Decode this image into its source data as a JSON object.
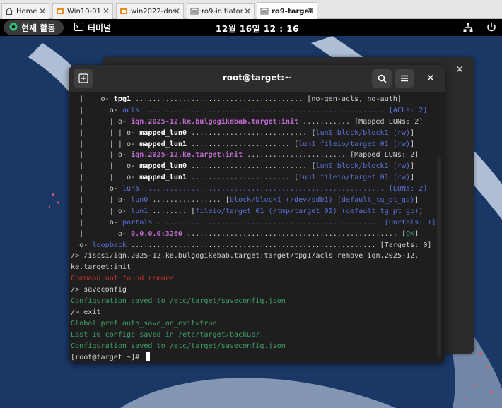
{
  "vm_tabs": [
    {
      "label": "Home",
      "icon": "home-icon",
      "active": false
    },
    {
      "label": "Win10-01",
      "icon": "vm-icon",
      "active": false
    },
    {
      "label": "win2022-dns",
      "icon": "vm-icon",
      "active": false
    },
    {
      "label": "ro9-initiator",
      "icon": "vm-icon",
      "active": false
    },
    {
      "label": "ro9-target",
      "icon": "vm-icon",
      "active": true
    }
  ],
  "topbar": {
    "activities": "현재 활동",
    "app_name": "터미널",
    "clock": "12월 16일  12 : 16"
  },
  "terminal": {
    "title": "root@target:~",
    "lines": [
      [
        {
          "t": "  |    o- "
        },
        {
          "t": "tpg1",
          "c": "c-b"
        },
        {
          "t": " ....................................... [no-gen-acls, no-auth]"
        }
      ],
      [
        {
          "t": "  |      o- "
        },
        {
          "t": "acls",
          "c": "c-blue"
        },
        {
          "t": " ........................................................ [ACLs: 2]",
          "c": "c-blue"
        }
      ],
      [
        {
          "t": "  |      | o- "
        },
        {
          "t": "iqn.2025-12.ke.bulgogikebab.target:init",
          "c": "c-mag"
        },
        {
          "t": " ........... [Mapped LUNs: 2]"
        }
      ],
      [
        {
          "t": "  |      | | o- "
        },
        {
          "t": "mapped_lun0",
          "c": "c-b"
        },
        {
          "t": " ........................... ["
        },
        {
          "t": "lun0 block/block1 (rw)",
          "c": "c-blue"
        },
        {
          "t": "]"
        }
      ],
      [
        {
          "t": "  |      | | o- "
        },
        {
          "t": "mapped_lun1",
          "c": "c-b"
        },
        {
          "t": " ....................... ["
        },
        {
          "t": "lun1 fileio/target_01 (rw)",
          "c": "c-blue"
        },
        {
          "t": "]"
        }
      ],
      [
        {
          "t": "  |      | o- "
        },
        {
          "t": "iqn.2025-12.ke.target:init",
          "c": "c-mag"
        },
        {
          "t": " ....................... [Mapped LUNs: 2]"
        }
      ],
      [
        {
          "t": "  |      |   o- "
        },
        {
          "t": "mapped_lun0",
          "c": "c-b"
        },
        {
          "t": " ........................... ["
        },
        {
          "t": "lun0 block/block1 (rw)",
          "c": "c-blue"
        },
        {
          "t": "]"
        }
      ],
      [
        {
          "t": "  |      |   o- "
        },
        {
          "t": "mapped_lun1",
          "c": "c-b"
        },
        {
          "t": " ....................... ["
        },
        {
          "t": "lun1 fileio/target_01 (rw)",
          "c": "c-blue"
        },
        {
          "t": "]"
        }
      ],
      [
        {
          "t": "  |      o- "
        },
        {
          "t": "luns",
          "c": "c-blue"
        },
        {
          "t": " ........................................................ [LUNs: 2]",
          "c": "c-blue"
        }
      ],
      [
        {
          "t": "  |      | o- "
        },
        {
          "t": "lun0",
          "c": "c-blue"
        },
        {
          "t": " ................ ["
        },
        {
          "t": "block/block1 (/dev/sdb1) (default_tg_pt_gp)",
          "c": "c-blue"
        },
        {
          "t": "]"
        }
      ],
      [
        {
          "t": "  |      | o- "
        },
        {
          "t": "lun1",
          "c": "c-blue"
        },
        {
          "t": " ........ ["
        },
        {
          "t": "fileio/target_01 (/tmp/target_01) (default_tg_pt_gp)",
          "c": "c-blue"
        },
        {
          "t": "]"
        }
      ],
      [
        {
          "t": "  |      o- "
        },
        {
          "t": "portals",
          "c": "c-blue"
        },
        {
          "t": " .................................................... [Portals: 1]",
          "c": "c-blue"
        }
      ],
      [
        {
          "t": "  |        o- "
        },
        {
          "t": "0.0.0.0:3260",
          "c": "c-mag"
        },
        {
          "t": " ................................................. ["
        },
        {
          "t": "OK",
          "c": "c-grn"
        },
        {
          "t": "]"
        }
      ],
      [
        {
          "t": "  o- "
        },
        {
          "t": "loopback",
          "c": "c-blue"
        },
        {
          "t": " ......................................................... [Targets: 0]"
        }
      ],
      [
        {
          "t": "/> /iscsi/iqn.2025-12.ke.bulgogikebab.target:target/tpg1/acls remove iqn.2025-12."
        }
      ],
      [
        {
          "t": "ke.target:init"
        }
      ],
      [
        {
          "t": "Command not found remove",
          "c": "c-red"
        }
      ],
      [
        {
          "t": "/> saveconfig"
        }
      ],
      [
        {
          "t": "Configuration saved to /etc/target/saveconfig.json",
          "c": "c-grn"
        }
      ],
      [
        {
          "t": "/> exit"
        }
      ],
      [
        {
          "t": "Global pref auto_save_on_exit=true",
          "c": "c-grn"
        }
      ],
      [
        {
          "t": "Last 10 configs saved in /etc/target/backup/.",
          "c": "c-grn"
        }
      ],
      [
        {
          "t": "Configuration saved to /etc/target/saveconfig.json",
          "c": "c-grn"
        }
      ],
      [
        {
          "t": "[root@target ~]# "
        }
      ]
    ]
  },
  "colors": {
    "desktop": "#1b3a6b",
    "terminal_bg": "#1e1e1e",
    "accent_blue": "#5c6fd6",
    "accent_magenta": "#c06ad0",
    "accent_green": "#3fa06a",
    "error_red": "#c83232"
  }
}
